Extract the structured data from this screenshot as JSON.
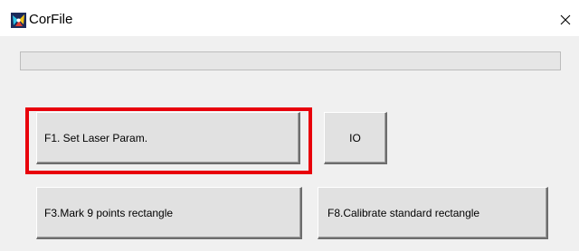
{
  "window": {
    "title": "CorFile",
    "icon": "app-icon",
    "close_glyph": "✕"
  },
  "progress": {
    "value": 0
  },
  "buttons": {
    "f1_label": "F1. Set Laser Param.",
    "io_label": "IO",
    "f3_label": "F3.Mark 9 points rectangle",
    "f8_label": "F8.Calibrate standard rectangle"
  },
  "colors": {
    "highlight": "#e8000b",
    "button_face": "#e1e1e1",
    "dialog_bg": "#f0f0f0"
  }
}
